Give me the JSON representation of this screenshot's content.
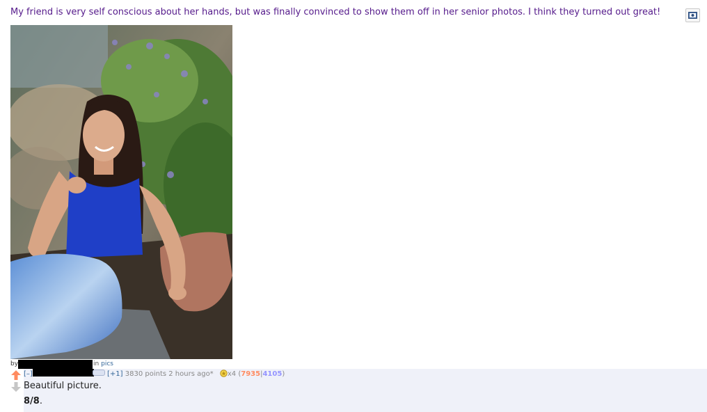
{
  "post": {
    "title": "My friend is very self conscious about her hands, but was finally convinced to show them off in her senior photos. I think they turned out great!",
    "expando_icon": "image-preview-icon",
    "byline_by": "by",
    "byline_in": "in",
    "subreddit": "pics"
  },
  "comment": {
    "collapse": "[–]",
    "score_change": "[+1]",
    "points": "3830 points 2 hours ago*",
    "gild_count": "x4",
    "vote_open": "(",
    "upvotes": "7935",
    "separator": "|",
    "downvotes": "4105",
    "vote_close": ")",
    "text": "Beautiful picture.",
    "bold_text": "8/8",
    "bold_suffix": "."
  },
  "colors": {
    "title": "#551a8b",
    "upvote_arrow": "#ff8b60",
    "downvote_arrow": "#c6c6c6",
    "upvote_count": "#ff8b60",
    "downvote_count": "#9494ff",
    "comment_bg": "#eff1f9"
  }
}
